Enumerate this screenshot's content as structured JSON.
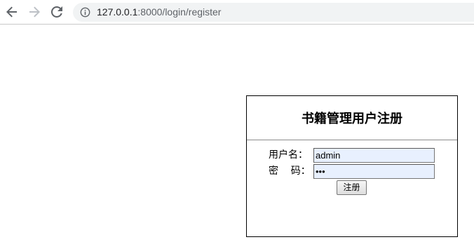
{
  "browser": {
    "url_host": "127.0.0.1",
    "url_path": ":8000/login/register",
    "icons": {
      "back": "arrow-left-icon",
      "forward": "arrow-right-icon",
      "reload": "reload-icon",
      "site_info": "info-icon"
    }
  },
  "register": {
    "title": "书籍管理用户注册",
    "username_label": "用户名：",
    "password_label": "密    码：",
    "username_value": "admin",
    "password_value": "•••",
    "submit_label": "注册"
  },
  "colors": {
    "autofill_background": "#e8f0fe",
    "omnibox_background": "#f1f3f4",
    "panel_border": "#000000"
  }
}
